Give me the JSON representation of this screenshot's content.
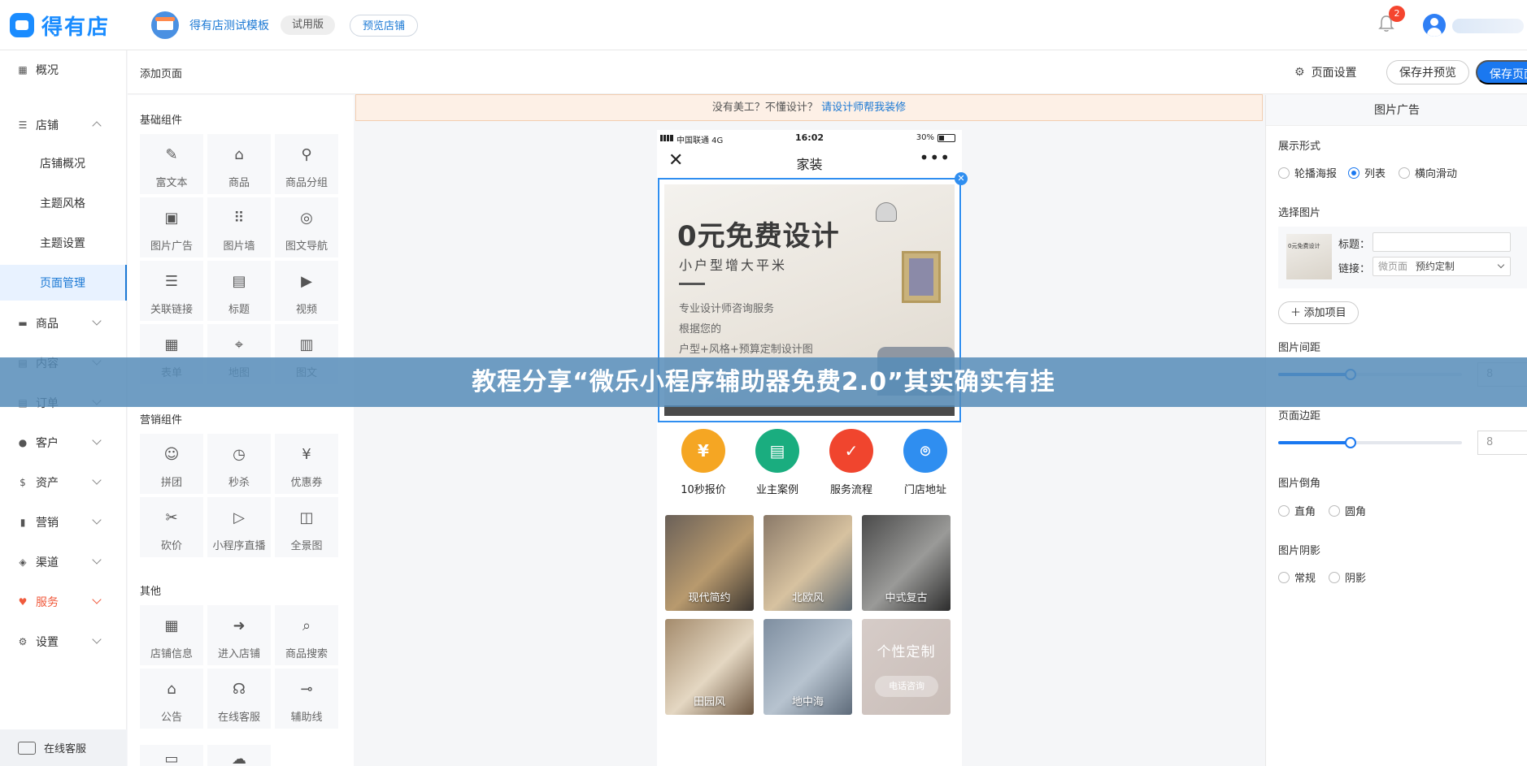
{
  "brand": {
    "name": "得有店",
    "color": "#1a8cff"
  },
  "header": {
    "store_name": "得有店测试模板",
    "trial_badge": "试用版",
    "preview_store": "预览店铺",
    "notification_count": "2"
  },
  "sidebar": {
    "items": [
      {
        "label": "概况",
        "icon": "grid-icon"
      },
      {
        "label": "店铺",
        "icon": "sliders-icon"
      },
      {
        "label": "店铺概况"
      },
      {
        "label": "主题风格"
      },
      {
        "label": "主题设置"
      },
      {
        "label": "页面管理"
      },
      {
        "label": "商品",
        "icon": "box-icon"
      },
      {
        "label": "内容",
        "icon": "file-icon"
      },
      {
        "label": "订单",
        "icon": "list-icon"
      },
      {
        "label": "客户",
        "icon": "users-icon"
      },
      {
        "label": "资产",
        "icon": "dollar-icon"
      },
      {
        "label": "营销",
        "icon": "bar-chart-icon"
      },
      {
        "label": "渠道",
        "icon": "layers-icon"
      },
      {
        "label": "服务",
        "icon": "heart-icon"
      },
      {
        "label": "设置",
        "icon": "gear-icon"
      }
    ],
    "online_service": "在线客服"
  },
  "page_header": {
    "title": "添加页面",
    "page_settings": "页面设置",
    "save_preview": "保存并预览",
    "save_page": "保存页面"
  },
  "components": {
    "basic_title": "基础组件",
    "basic": [
      "富文本",
      "商品",
      "商品分组",
      "图片广告",
      "图片墙",
      "图文导航",
      "关联链接",
      "标题",
      "视频",
      "表单",
      "地图",
      "图文"
    ],
    "marketing_title": "营销组件",
    "marketing": [
      "拼团",
      "秒杀",
      "优惠券",
      "砍价",
      "小程序直播",
      "全景图"
    ],
    "other_title": "其他",
    "other": [
      "店铺信息",
      "进入店铺",
      "商品搜索",
      "公告",
      "在线客服",
      "辅助线"
    ]
  },
  "tip": {
    "text": "没有美工？不懂设计？",
    "link": "请设计师帮我装修"
  },
  "phone": {
    "carrier": "中国联通   4G",
    "time": "16:02",
    "battery": "30%",
    "title": "家装",
    "close": "✕",
    "more": "•••",
    "banner": {
      "title": "0元免费设计",
      "subtitle": "小户型增大平米",
      "line1": "专业设计师咨询服务",
      "line2": "根据您的",
      "line3": "户型+风格+预算定制设计图"
    },
    "quick": [
      {
        "label": "10秒报价",
        "color": "#f5a623",
        "glyph": "¥"
      },
      {
        "label": "业主案例",
        "color": "#1aad7f",
        "glyph": "▤"
      },
      {
        "label": "服务流程",
        "color": "#f0452e",
        "glyph": "✓"
      },
      {
        "label": "门店地址",
        "color": "#2f8ef0",
        "glyph": "⌾"
      }
    ],
    "styles": [
      "现代简约",
      "北欧风",
      "中式复古",
      "田园风",
      "地中海"
    ],
    "custom_title": "个性定制",
    "custom_button": "电话咨询"
  },
  "right": {
    "title": "图片广告",
    "display_label": "展示形式",
    "display_options": [
      "轮播海报",
      "列表",
      "横向滑动"
    ],
    "display_selected": "列表",
    "select_label": "选择图片",
    "item_title_label": "标题：",
    "item_link_label": "链接：",
    "link_prefix": "微页面",
    "link_value": "预约定制",
    "thumb_text": "0元免费设计",
    "add_item": "＋  添加项目",
    "spacing_label": "图片间距",
    "spacing_value": "8",
    "margin_label": "页面边距",
    "margin_value": "8",
    "corner_label": "图片倒角",
    "corner_options": [
      "直角",
      "圆角"
    ],
    "shadow_label": "图片阴影",
    "shadow_options": [
      "常规",
      "阴影"
    ]
  },
  "overlay": {
    "text": "教程分享“微乐小程序辅助器免费2.0”其实确实有挂"
  }
}
